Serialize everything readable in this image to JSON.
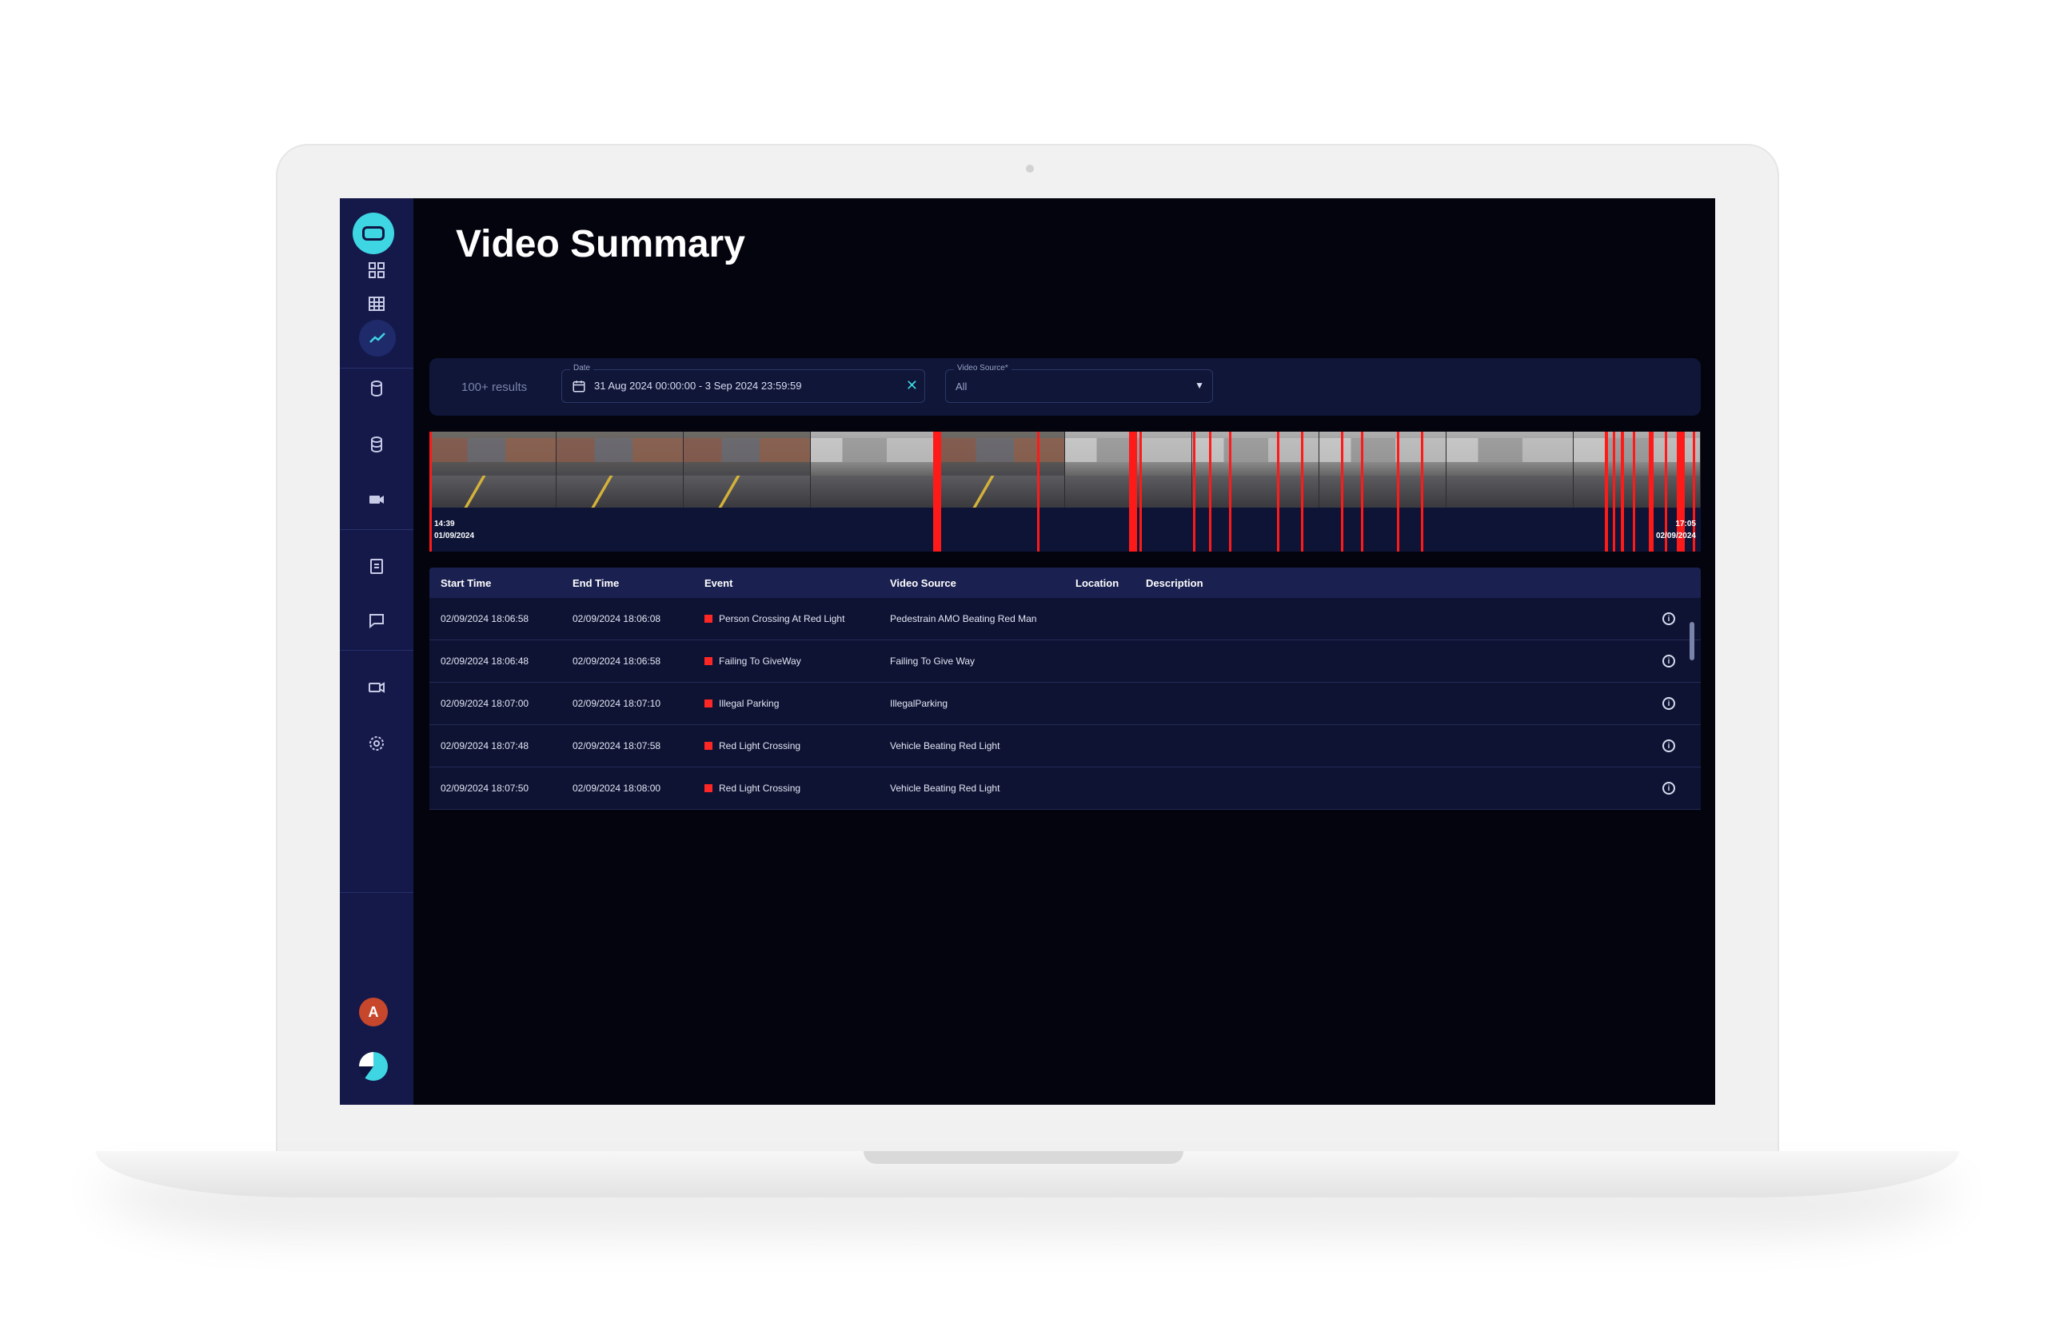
{
  "page": {
    "title": "Video Summary"
  },
  "filters": {
    "results_count": "100+ results",
    "date_label": "Date",
    "date_value": "31 Aug 2024 00:00:00 - 3 Sep 2024 23:59:59",
    "source_label": "Video Source*",
    "source_value": "All"
  },
  "timeline": {
    "start_time": "14:39",
    "start_date": "01/09/2024",
    "end_time": "17:05",
    "end_date": "02/09/2024"
  },
  "table": {
    "headers": {
      "start": "Start Time",
      "end": "End Time",
      "event": "Event",
      "source": "Video Source",
      "location": "Location",
      "description": "Description"
    },
    "rows": [
      {
        "start": "02/09/2024 18:06:58",
        "end": "02/09/2024 18:06:08",
        "event": "Person Crossing At Red Light",
        "source": "Pedestrain AMO Beating Red Man",
        "location": "",
        "description": ""
      },
      {
        "start": "02/09/2024 18:06:48",
        "end": "02/09/2024 18:06:58",
        "event": "Failing To GiveWay",
        "source": "Failing To Give Way",
        "location": "",
        "description": ""
      },
      {
        "start": "02/09/2024 18:07:00",
        "end": "02/09/2024 18:07:10",
        "event": "Illegal Parking",
        "source": "IllegalParking",
        "location": "",
        "description": ""
      },
      {
        "start": "02/09/2024 18:07:48",
        "end": "02/09/2024 18:07:58",
        "event": "Red Light Crossing",
        "source": "Vehicle Beating Red Light",
        "location": "",
        "description": ""
      },
      {
        "start": "02/09/2024 18:07:50",
        "end": "02/09/2024 18:08:00",
        "event": "Red Light Crossing",
        "source": "Vehicle Beating Red Light",
        "location": "",
        "description": ""
      }
    ]
  },
  "sidebar": {
    "avatar_initial": "A",
    "icons": [
      "dashboard-icon",
      "grid-icon",
      "analytics-icon",
      "database-icon",
      "storage-icon",
      "camera-icon",
      "report-icon",
      "chat-icon",
      "video-icon",
      "settings-icon"
    ]
  },
  "colors": {
    "accent": "#3fd6e4",
    "sidebar": "#14194a",
    "background": "#04040f",
    "event_marker": "#ff1a1a"
  }
}
